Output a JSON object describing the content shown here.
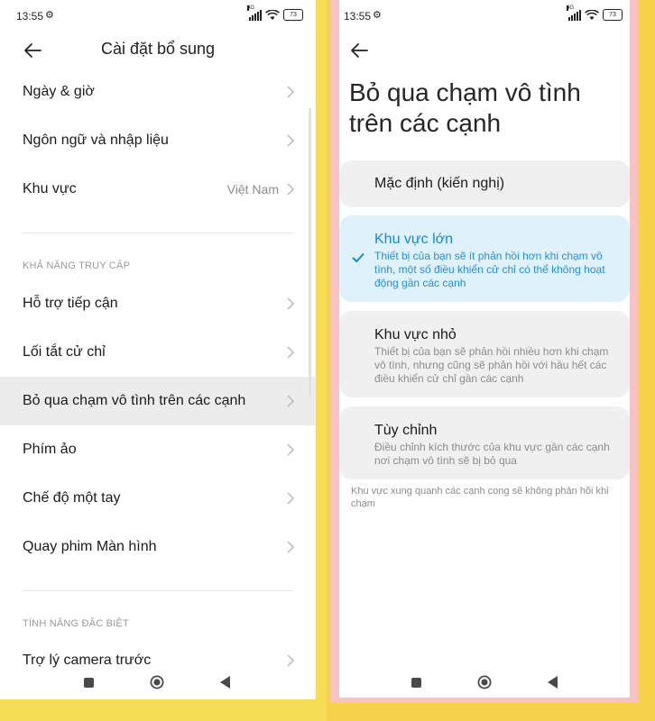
{
  "status_bar": {
    "time": "13:55",
    "network": "4G",
    "battery": "73"
  },
  "left_screen": {
    "title": "Cài đặt bổ sung",
    "items": [
      {
        "label": "Ngày & giờ",
        "value": ""
      },
      {
        "label": "Ngôn ngữ và nhập liệu",
        "value": ""
      },
      {
        "label": "Khu vực",
        "value": "Việt Nam"
      }
    ],
    "section_accessibility": "KHẢ NĂNG TRUY CẬP",
    "accessibility_items": [
      {
        "label": "Hỗ trợ tiếp cận"
      },
      {
        "label": "Lối tắt cử chỉ"
      },
      {
        "label": "Bỏ qua chạm vô tình trên các cạnh",
        "highlighted": true
      },
      {
        "label": "Phím ảo"
      },
      {
        "label": "Chế độ một tay"
      },
      {
        "label": "Quay phim Màn hình"
      }
    ],
    "section_special": "TÍNH NĂNG ĐẶC BIỆT",
    "special_items": [
      {
        "label": "Trợ lý camera trước"
      }
    ]
  },
  "right_screen": {
    "title": "Bỏ qua chạm vô tình trên các cạnh",
    "options": [
      {
        "title": "Mặc định (kiến nghị)",
        "description": "",
        "selected": false
      },
      {
        "title": "Khu vực lớn",
        "description": "Thiết bị của bạn sẽ ít phản hồi hơn khi chạm vô tình, một số điều khiển cử chỉ có thể không hoạt động gần các cạnh",
        "selected": true
      },
      {
        "title": "Khu vực nhỏ",
        "description": "Thiết bị của bạn sẽ phản hồi nhiều hơn khi chạm vô tình, nhưng cũng sẽ phản hồi với hầu hết các điều khiển cử chỉ gần các cạnh",
        "selected": false
      },
      {
        "title": "Tùy chỉnh",
        "description": "Điều chỉnh kích thước của khu vực gần các cạnh nơi chạm vô tình sẽ bị bỏ qua",
        "selected": false
      }
    ],
    "footer_note": "Khu vực xung quanh các cạnh cong sẽ không phản hồi khi chạm"
  },
  "icons": {
    "back": "arrow-left-icon",
    "chevron": "chevron-right-icon",
    "check": "check-icon",
    "settings": "gear-icon",
    "wifi": "wifi-icon",
    "signal": "signal-icon",
    "battery": "battery-icon",
    "nav_recent": "square-icon",
    "nav_home": "home-circle-icon",
    "nav_back": "triangle-back-icon"
  },
  "colors": {
    "accent": "#1588d8",
    "selected_bg": "#dff1fb",
    "card_bg": "#f0f0f0",
    "highlight_row": "#ececec",
    "backdrop": "#f5de55",
    "frame": "#f6c2c2"
  }
}
